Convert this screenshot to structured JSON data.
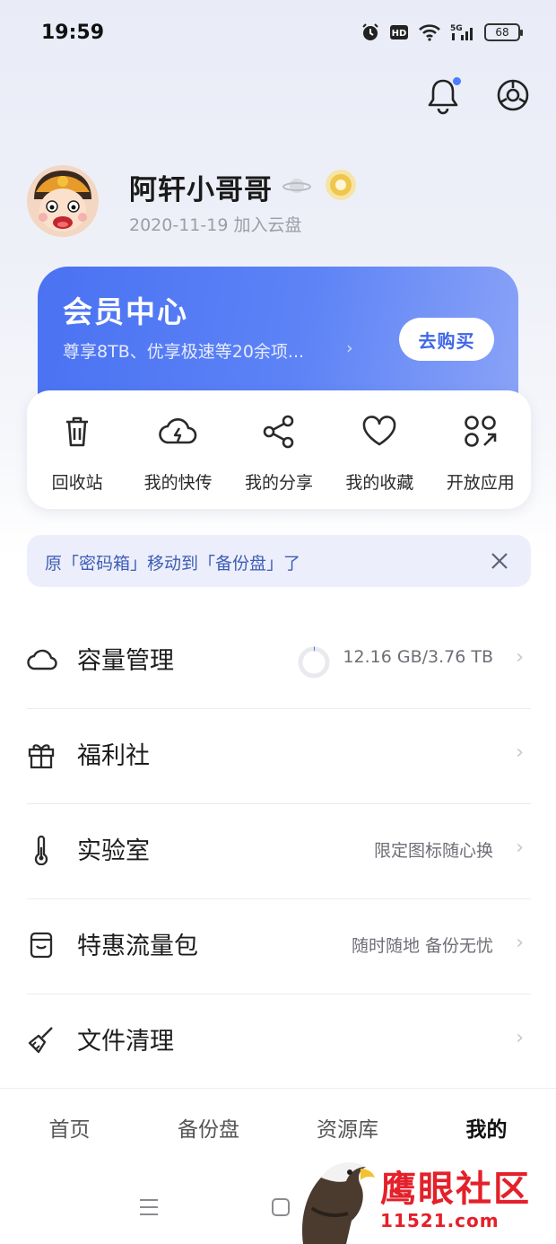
{
  "status_bar": {
    "time": "19:59",
    "battery": "68",
    "network": "5G",
    "hd": "HD"
  },
  "header": {
    "icons": [
      "bell-icon",
      "settings-icon"
    ]
  },
  "profile": {
    "username": "阿轩小哥哥",
    "join_date": "2020-11-19 加入云盘"
  },
  "vip": {
    "title": "会员中心",
    "subtitle": "尊享8TB、优享极速等20余项...",
    "arrow": "›",
    "buy_label": "去购买"
  },
  "quick_actions": [
    {
      "label": "回收站",
      "icon": "trash-icon"
    },
    {
      "label": "我的快传",
      "icon": "cloud-flash-icon"
    },
    {
      "label": "我的分享",
      "icon": "share-icon"
    },
    {
      "label": "我的收藏",
      "icon": "heart-icon"
    },
    {
      "label": "开放应用",
      "icon": "apps-icon"
    }
  ],
  "notice": {
    "text": "原「密码箱」移动到「备份盘」了"
  },
  "menu": [
    {
      "label": "容量管理",
      "value": "12.16 GB/3.76 TB",
      "icon": "cloud-icon",
      "usage_fraction": 0.003
    },
    {
      "label": "福利社",
      "value": "",
      "icon": "gift-icon"
    },
    {
      "label": "实验室",
      "value": "限定图标随心换",
      "icon": "thermometer-icon"
    },
    {
      "label": "特惠流量包",
      "value": "随时随地 备份无忧",
      "icon": "sim-icon"
    },
    {
      "label": "文件清理",
      "value": "",
      "icon": "broom-icon"
    }
  ],
  "chevron": "›",
  "tabs": [
    {
      "label": "首页",
      "active": false
    },
    {
      "label": "备份盘",
      "active": false
    },
    {
      "label": "资源库",
      "active": false
    },
    {
      "label": "我的",
      "active": true
    }
  ],
  "watermark": {
    "title": "鹰眼社区",
    "url": "11521.com"
  },
  "colors": {
    "accent": "#4a72f2",
    "notice_text": "#3d5cb5",
    "watermark": "#e4202a"
  }
}
